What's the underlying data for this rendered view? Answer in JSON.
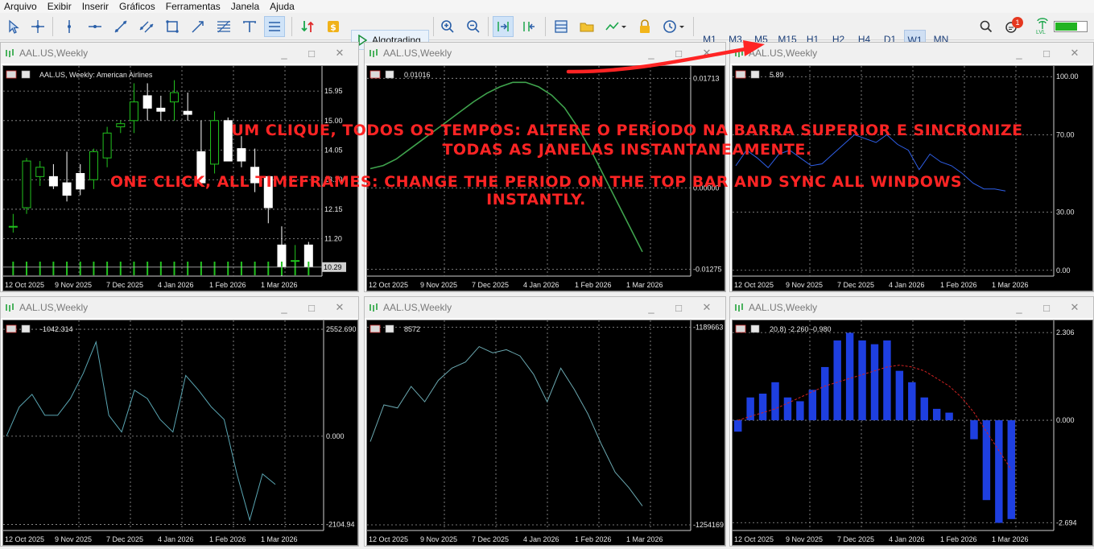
{
  "menu": [
    "Arquivo",
    "Exibir",
    "Inserir",
    "Gráficos",
    "Ferramentas",
    "Janela",
    "Ajuda"
  ],
  "toolbar": {
    "algotrading_label": "Algotrading",
    "timeframes": [
      "M1",
      "M5",
      "M15",
      "H1",
      "H2",
      "H4",
      "D1",
      "W1",
      "MN"
    ],
    "timeframes_display": [
      "M1",
      "M3",
      "M5",
      "M15",
      "H1",
      "H2",
      "H4",
      "D1",
      "W1",
      "MN"
    ],
    "active_timeframe": "W1",
    "notification_count": "1",
    "signal_label": "LVL"
  },
  "windows": [
    {
      "title": "AAL.US,Weekly",
      "header": "AAL.US, Weekly:  American Airlines",
      "y_labels": [
        "15.95",
        "15.00",
        "14.05",
        "13.10",
        "12.15",
        "11.20"
      ],
      "price_label": "10.29",
      "x_labels": [
        "12 Oct 2025",
        "9 Nov 2025",
        "7 Dec 2025",
        "4 Jan 2026",
        "1 Feb 2026",
        "1 Mar 2026"
      ]
    },
    {
      "title": "AAL.US,Weekly",
      "header": "0.01016",
      "y_labels": [
        "0.01713",
        "0.00000",
        "-0.01275"
      ],
      "x_labels": [
        "12 Oct 2025",
        "9 Nov 2025",
        "7 Dec 2025",
        "4 Jan 2026",
        "1 Feb 2026",
        "1 Mar 2026"
      ]
    },
    {
      "title": "AAL.US,Weekly",
      "header": "5.89",
      "y_labels": [
        "100.00",
        "70.00",
        "30.00",
        "0.00"
      ],
      "x_labels": [
        "12 Oct 2025",
        "9 Nov 2025",
        "7 Dec 2025",
        "4 Jan 2026",
        "1 Feb 2026",
        "1 Mar 2026"
      ]
    },
    {
      "title": "AAL.US,Weekly",
      "header": "-1042.314",
      "y_labels": [
        "2552.690",
        "0.000",
        "-2104.94"
      ],
      "x_labels": [
        "12 Oct 2025",
        "9 Nov 2025",
        "7 Dec 2025",
        "4 Jan 2026",
        "1 Feb 2026",
        "1 Mar 2026"
      ]
    },
    {
      "title": "AAL.US,Weekly",
      "header": "8572",
      "y_labels": [
        "-1189663",
        "-1254169"
      ],
      "x_labels": [
        "12 Oct 2025",
        "9 Nov 2025",
        "7 Dec 2025",
        "4 Jan 2026",
        "1 Feb 2026",
        "1 Mar 2026"
      ]
    },
    {
      "title": "AAL.US,Weekly",
      "header": "20,8) -2.260 -0.980",
      "y_labels": [
        "2.306",
        "0.000",
        "-2.694"
      ],
      "x_labels": [
        "12 Oct 2025",
        "9 Nov 2025",
        "7 Dec 2025",
        "4 Jan 2026",
        "1 Feb 2026",
        "1 Mar 2026"
      ]
    }
  ],
  "overlay": {
    "pt_line1": "UM CLIQUE, TODOS OS TEMPOS: ALTERE O PERÍODO NA BARRA SUPERIOR E SINCRONIZE",
    "pt_line2": "TODAS AS JANELAS INSTANTANEAMENTE.",
    "en_line1": "ONE CLICK, ALL TIMEFRAMES: CHANGE THE PERIOD ON THE TOP BAR AND SYNC ALL WINDOWS",
    "en_line2": "INSTANTLY.",
    "color": "#ff2424"
  },
  "colors": {
    "chart_bg": "#000000",
    "bull": "#22c21e",
    "grid": "#9a9a9a",
    "accent_blue": "#1e3fe0"
  },
  "chart_data": [
    {
      "type": "candlestick",
      "series": [
        {
          "name": "AAL.US",
          "ohlc": [
            [
              11.6,
              12.0,
              11.4,
              11.6
            ],
            [
              12.2,
              13.8,
              12.0,
              13.7
            ],
            [
              13.2,
              13.7,
              12.9,
              13.5
            ],
            [
              13.2,
              13.6,
              12.8,
              12.9
            ],
            [
              13.0,
              14.0,
              12.4,
              12.6
            ],
            [
              13.3,
              13.6,
              12.6,
              12.8
            ],
            [
              13.1,
              14.1,
              12.8,
              14.0
            ],
            [
              13.8,
              14.8,
              13.5,
              14.6
            ],
            [
              14.8,
              15.0,
              14.6,
              14.9
            ],
            [
              15.0,
              16.2,
              14.6,
              15.6
            ],
            [
              15.8,
              16.2,
              15.0,
              15.4
            ],
            [
              15.4,
              15.8,
              15.0,
              15.3
            ],
            [
              15.6,
              16.3,
              15.0,
              15.9
            ],
            [
              15.3,
              15.9,
              15.0,
              15.2
            ],
            [
              14.0,
              15.0,
              14.0,
              13.0
            ],
            [
              13.6,
              15.3,
              13.3,
              15.0
            ],
            [
              15.0,
              15.1,
              14.2,
              13.7
            ],
            [
              14.1,
              14.5,
              13.5,
              13.7
            ],
            [
              13.5,
              14.1,
              12.7,
              13.0
            ],
            [
              13.2,
              13.2,
              11.7,
              12.2
            ],
            [
              11.0,
              11.6,
              10.0,
              10.3
            ],
            [
              10.5,
              11.0,
              10.2,
              10.5
            ],
            [
              11.0,
              11.1,
              10.2,
              10.3
            ]
          ]
        }
      ],
      "volume": [
        18,
        18,
        18,
        18,
        18,
        18,
        18,
        18,
        18,
        18,
        18,
        18,
        18,
        18,
        18,
        18,
        18,
        18,
        18,
        18,
        18,
        18,
        18
      ],
      "ylim": [
        10.0,
        16.6
      ]
    },
    {
      "type": "line",
      "series": [
        {
          "values": [
            0.003,
            0.0035,
            0.0045,
            0.006,
            0.0075,
            0.009,
            0.0105,
            0.012,
            0.0135,
            0.0148,
            0.0158,
            0.0165,
            0.0165,
            0.0158,
            0.0145,
            0.0125,
            0.0095,
            0.006,
            0.002,
            -0.002,
            -0.006,
            -0.01
          ]
        }
      ],
      "ylim": [
        -0.0138,
        0.0183
      ]
    },
    {
      "type": "line",
      "series": [
        {
          "values": [
            54,
            62,
            58,
            53,
            60,
            62,
            58,
            54,
            55,
            60,
            65,
            70,
            68,
            66,
            70,
            65,
            62,
            52,
            60,
            56,
            54,
            50,
            45,
            42,
            42,
            41
          ]
        }
      ],
      "ylim": [
        -3,
        103
      ]
    },
    {
      "type": "line",
      "series": [
        {
          "values": [
            0,
            700,
            1000,
            500,
            500,
            900,
            1500,
            2250,
            500,
            100,
            1100,
            900,
            400,
            100,
            1450,
            1100,
            700,
            400,
            -900,
            -2000,
            -900,
            -1150
          ]
        }
      ],
      "ylim": [
        -2250,
        2650
      ]
    },
    {
      "type": "line",
      "series": [
        {
          "values": [
            -1227000,
            -1215000,
            -1216000,
            -1209000,
            -1214000,
            -1207000,
            -1203000,
            -1201000,
            -1196000,
            -1198000,
            -1197000,
            -1199000,
            -1205000,
            -1214000,
            -1203000,
            -1210000,
            -1218000,
            -1228000,
            -1237000,
            -1242000,
            -1248000
          ]
        }
      ],
      "ylim": [
        -1256000,
        -1189000
      ]
    },
    {
      "type": "bar",
      "series": [
        {
          "name": "histogram",
          "values": [
            -0.3,
            0.6,
            0.7,
            1.0,
            0.6,
            0.5,
            0.8,
            1.4,
            2.1,
            2.3,
            2.1,
            2.0,
            2.1,
            1.3,
            1.0,
            0.6,
            0.3,
            0.2,
            0.0,
            -0.5,
            -2.1,
            -2.7,
            -2.6
          ]
        },
        {
          "name": "signal",
          "values": [
            0.0,
            0.1,
            0.2,
            0.3,
            0.45,
            0.6,
            0.75,
            0.9,
            1.0,
            1.1,
            1.2,
            1.3,
            1.4,
            1.45,
            1.4,
            1.3,
            1.1,
            0.9,
            0.6,
            0.2,
            -0.3,
            -0.8,
            -1.3
          ]
        }
      ],
      "ylim": [
        -2.9,
        2.5
      ]
    }
  ]
}
